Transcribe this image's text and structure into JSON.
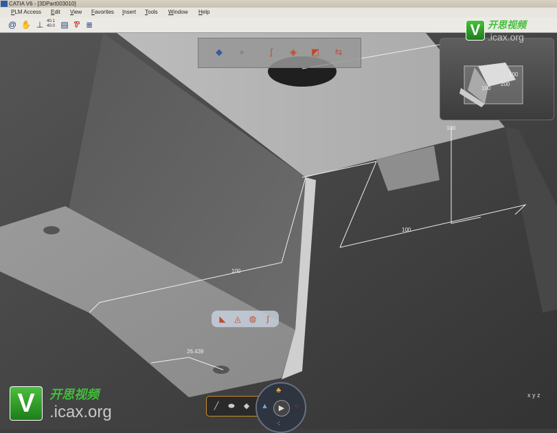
{
  "window": {
    "title": "CATIA V6 - [3DPart003010]"
  },
  "menu": [
    "PLM Access",
    "Edit",
    "View",
    "Favorites",
    "Insert",
    "Tools",
    "Window",
    "Help"
  ],
  "toolbar": {
    "icons": [
      "spiral-icon",
      "hand-icon",
      "axis-icon",
      "coordinates-icon",
      "cylinder-icon",
      "color-icon",
      "stack-icon"
    ],
    "coord_label": "40.1\n40.0"
  },
  "dimensions": {
    "d1": "100",
    "d2": "100",
    "d3": "100",
    "d4": "26.439"
  },
  "thumbnail": {
    "labels": [
      "100",
      "200",
      "100"
    ]
  },
  "watermark": {
    "letter": "V",
    "chinese": "开思视频",
    "domain": ".icax.org"
  },
  "compass": {
    "label": "x y z"
  },
  "colors": {
    "background": "#3f3f3f",
    "part": "#b4b4b4",
    "accent": "#c8902a"
  }
}
